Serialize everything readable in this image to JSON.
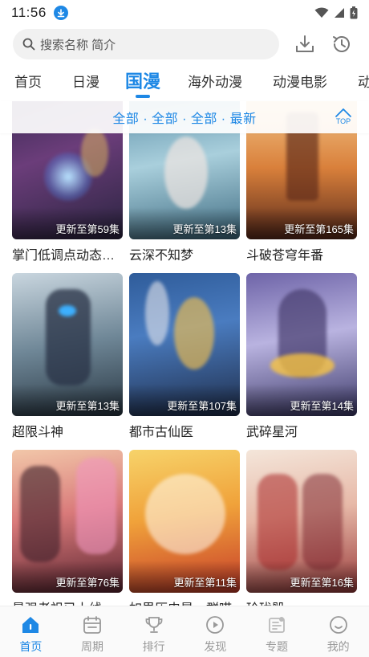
{
  "status_bar": {
    "time": "11:56"
  },
  "search": {
    "placeholder": "搜索名称 简介"
  },
  "tabs": [
    {
      "label": "首页"
    },
    {
      "label": "日漫"
    },
    {
      "label": "国漫"
    },
    {
      "label": "海外动漫"
    },
    {
      "label": "动漫电影"
    },
    {
      "label": "动"
    }
  ],
  "active_tab": "国漫",
  "filter": {
    "text": "全部 · 全部 · 全部 · 最新",
    "top_label": "TOP"
  },
  "cards": [
    {
      "title": "掌门低调点动态漫画",
      "badge": "更新至第59集"
    },
    {
      "title": "云深不知梦",
      "badge": "更新至第13集"
    },
    {
      "title": "斗破苍穹年番",
      "badge": "更新至第165集"
    },
    {
      "title": "超限斗神",
      "badge": "更新至第13集"
    },
    {
      "title": "都市古仙医",
      "badge": "更新至第107集"
    },
    {
      "title": "武碎星河",
      "badge": "更新至第14集"
    },
    {
      "title": "最强老祖已上线",
      "badge": "更新至第76集"
    },
    {
      "title": "如果历史是一群喵",
      "badge": "更新至第11集"
    },
    {
      "title": "玲珑骰",
      "badge": "更新至第16集"
    }
  ],
  "bottom_nav": [
    {
      "label": "首页"
    },
    {
      "label": "周期"
    },
    {
      "label": "排行"
    },
    {
      "label": "发现"
    },
    {
      "label": "专题"
    },
    {
      "label": "我的"
    }
  ],
  "colors": {
    "accent": "#1e88e5",
    "inactive": "#999999"
  }
}
